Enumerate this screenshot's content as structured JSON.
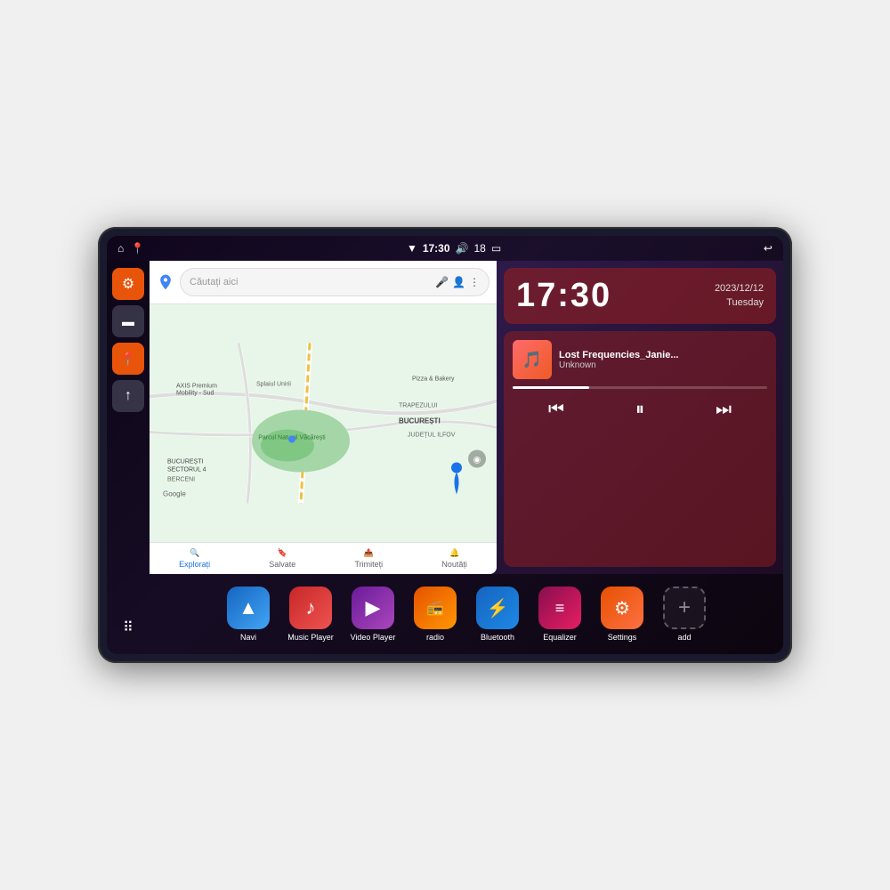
{
  "statusBar": {
    "leftIcons": [
      "⌂",
      "📍"
    ],
    "wifi": "▼",
    "time": "17:30",
    "volume": "🔊",
    "battery": "18",
    "batteryIcon": "🔋",
    "back": "↩"
  },
  "clock": {
    "time": "17:30",
    "date": "2023/12/12",
    "day": "Tuesday"
  },
  "music": {
    "title": "Lost Frequencies_Janie...",
    "artist": "Unknown",
    "progressPercent": 30
  },
  "maps": {
    "searchPlaceholder": "Căutați aici",
    "location": "București",
    "bottomItems": [
      {
        "label": "Explorați",
        "active": true
      },
      {
        "label": "Salvate",
        "active": false
      },
      {
        "label": "Trimiteți",
        "active": false
      },
      {
        "label": "Noutăți",
        "active": false
      }
    ]
  },
  "sidebar": {
    "icons": [
      "⚙",
      "📁",
      "📍",
      "↑"
    ]
  },
  "apps": [
    {
      "label": "Navi",
      "icon": "↑",
      "bg": "bg-blue"
    },
    {
      "label": "Music Player",
      "icon": "♪",
      "bg": "bg-red"
    },
    {
      "label": "Video Player",
      "icon": "▶",
      "bg": "bg-purple"
    },
    {
      "label": "radio",
      "icon": "📻",
      "bg": "bg-orange-dark"
    },
    {
      "label": "Bluetooth",
      "icon": "⚡",
      "bg": "bg-blue-bt"
    },
    {
      "label": "Equalizer",
      "icon": "≡",
      "bg": "bg-maroon"
    },
    {
      "label": "Settings",
      "icon": "⚙",
      "bg": "bg-orange"
    },
    {
      "label": "add",
      "icon": "+",
      "bg": "bg-dashed"
    }
  ]
}
